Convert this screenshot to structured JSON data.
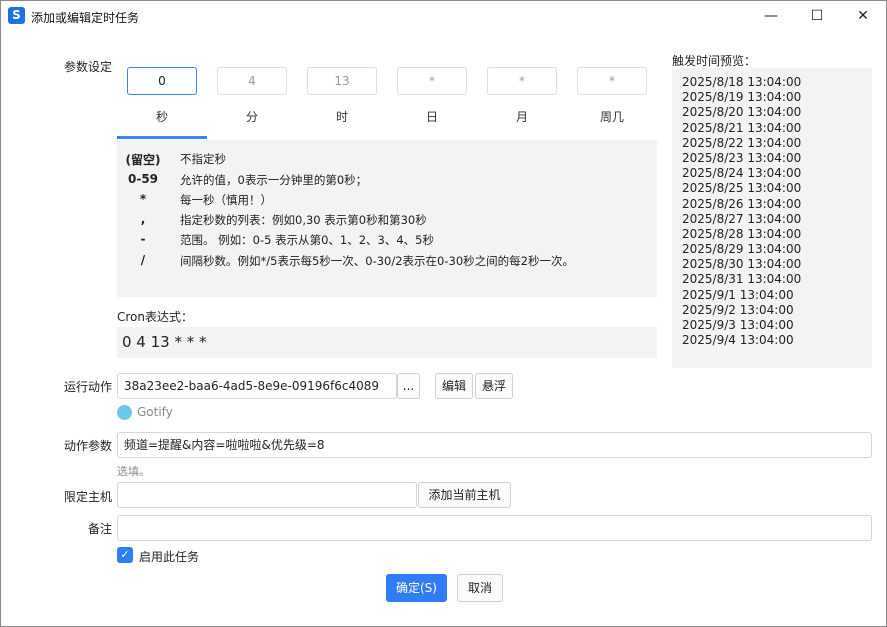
{
  "window": {
    "title": "添加或编辑定时任务",
    "min": "—",
    "max": "☐",
    "close": "✕"
  },
  "params": {
    "label": "参数设定",
    "fields": [
      {
        "value": "0",
        "tab": "秒"
      },
      {
        "value": "4",
        "tab": "分"
      },
      {
        "value": "13",
        "tab": "时"
      },
      {
        "value": "*",
        "tab": "日"
      },
      {
        "value": "*",
        "tab": "月"
      },
      {
        "value": "*",
        "tab": "周几"
      }
    ],
    "help": [
      {
        "key": "(留空)",
        "desc": "不指定秒"
      },
      {
        "key": "0-59",
        "desc": "允许的值，0表示一分钟里的第0秒；"
      },
      {
        "key": "*",
        "desc": "每一秒（慎用！）"
      },
      {
        "key": ",",
        "desc": "指定秒数的列表：例如0,30 表示第0秒和第30秒"
      },
      {
        "key": "-",
        "desc": "范围。 例如：0-5 表示从第0、1、2、3、4、5秒"
      },
      {
        "key": "/",
        "desc": "间隔秒数。例如*/5表示每5秒一次、0-30/2表示在0-30秒之间的每2秒一次。"
      }
    ]
  },
  "cron": {
    "label": "Cron表达式：",
    "value": "0 4 13 * * *"
  },
  "preview": {
    "label": "触发时间预览：",
    "items": [
      "2025/8/18 13:04:00",
      "2025/8/19 13:04:00",
      "2025/8/20 13:04:00",
      "2025/8/21 13:04:00",
      "2025/8/22 13:04:00",
      "2025/8/23 13:04:00",
      "2025/8/24 13:04:00",
      "2025/8/25 13:04:00",
      "2025/8/26 13:04:00",
      "2025/8/27 13:04:00",
      "2025/8/28 13:04:00",
      "2025/8/29 13:04:00",
      "2025/8/30 13:04:00",
      "2025/8/31 13:04:00",
      "2025/9/1 13:04:00",
      "2025/9/2 13:04:00",
      "2025/9/3 13:04:00",
      "2025/9/4 13:04:00"
    ]
  },
  "action": {
    "label": "运行动作",
    "value": "38a23ee2-baa6-4ad5-8e9e-09196f6c4089",
    "browse": "...",
    "edit": "编辑",
    "float": "悬浮",
    "plugin_name": "Gotify"
  },
  "action_params": {
    "label": "动作参数",
    "value": "频道=提醒&内容=啦啦啦&优先级=8",
    "hint": "选填。"
  },
  "host": {
    "label": "限定主机",
    "value": "",
    "add_current": "添加当前主机"
  },
  "note": {
    "label": "备注",
    "value": ""
  },
  "enable": {
    "label": "启用此任务",
    "checked": true
  },
  "buttons": {
    "ok": "确定(S)",
    "cancel": "取消"
  }
}
